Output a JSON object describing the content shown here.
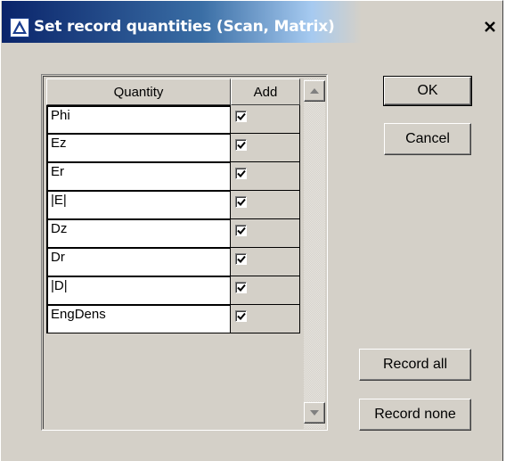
{
  "window": {
    "title": "Set record quantities (Scan, Matrix)",
    "close_glyph": "✕",
    "icon": "app-triangle-icon"
  },
  "grid": {
    "columns": [
      "Quantity",
      "Add"
    ],
    "rows": [
      {
        "quantity": "Phi",
        "add": true
      },
      {
        "quantity": "Ez",
        "add": true
      },
      {
        "quantity": "Er",
        "add": true
      },
      {
        "quantity": "|E|",
        "add": true
      },
      {
        "quantity": "Dz",
        "add": true
      },
      {
        "quantity": "Dr",
        "add": true
      },
      {
        "quantity": "|D|",
        "add": true
      },
      {
        "quantity": "EngDens",
        "add": true
      }
    ]
  },
  "buttons": {
    "ok": "OK",
    "cancel": "Cancel",
    "record_all": "Record all",
    "record_none": "Record none"
  },
  "colors": {
    "dialog_face": "#d4d0c8",
    "title_active": "#0a246a",
    "title_gradient_end": "#a6caf0"
  }
}
